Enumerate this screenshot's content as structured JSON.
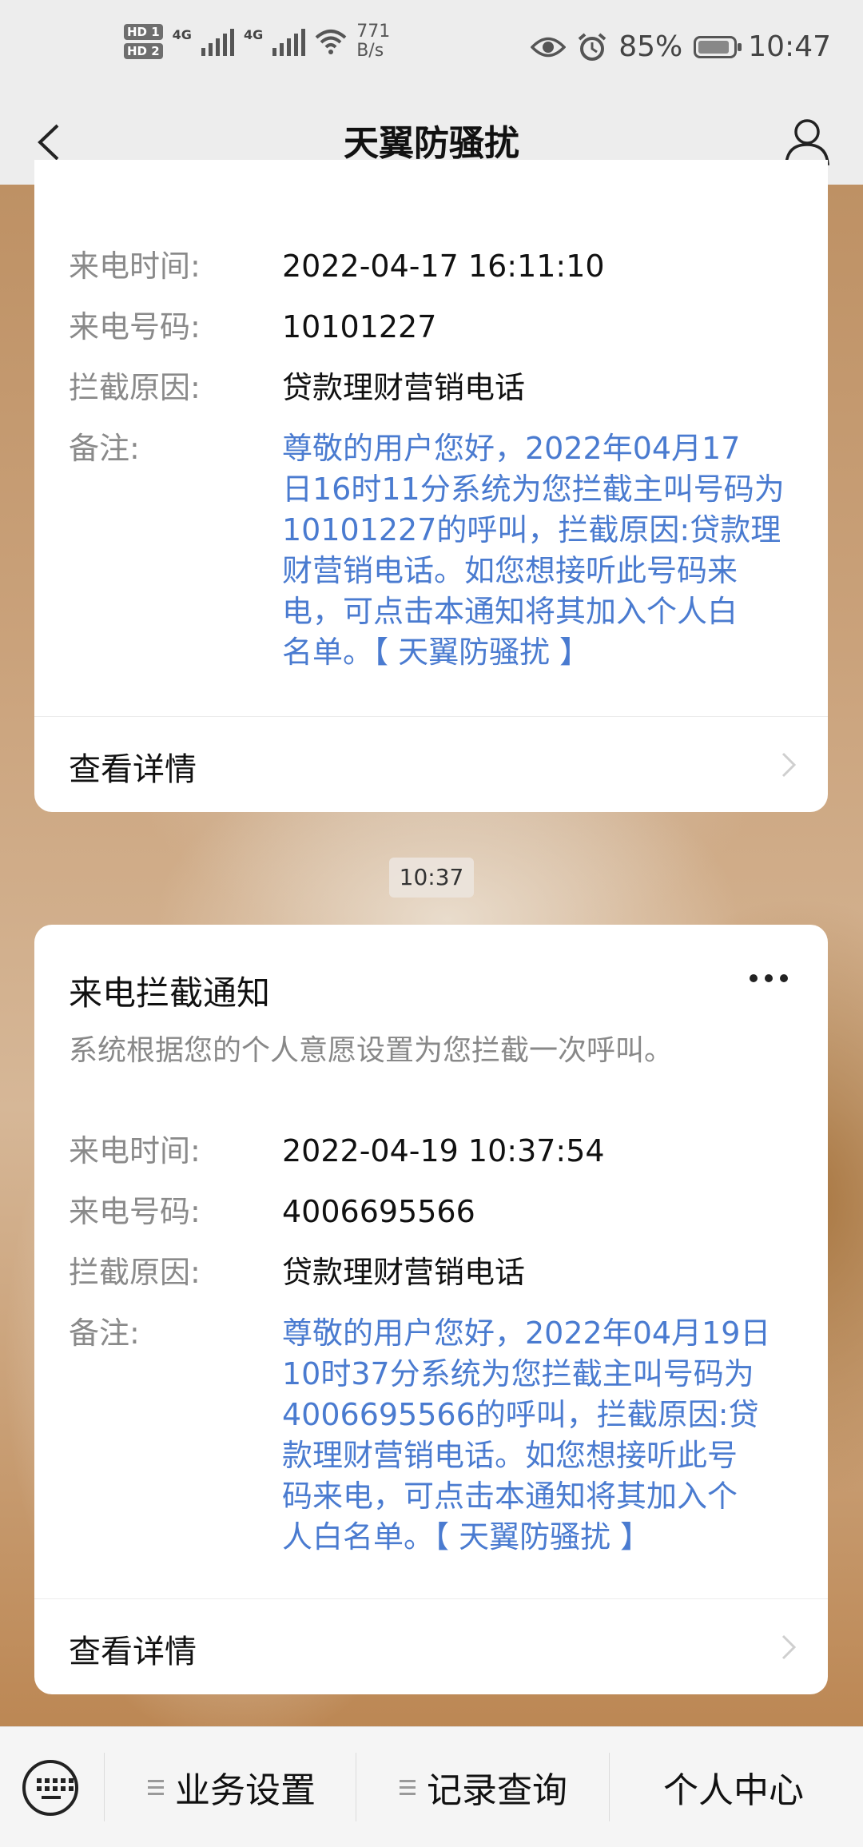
{
  "status_bar": {
    "hd1": "HD 1",
    "hd2": "HD 2",
    "net1": "4G",
    "net2": "4G",
    "speed_value": "771",
    "speed_unit": "B/s",
    "battery": "85%",
    "time": "10:47"
  },
  "header": {
    "title": "天翼防骚扰"
  },
  "card1": {
    "rows": [
      {
        "label": "来电时间:",
        "value": "2022-04-17 16:11:10"
      },
      {
        "label": "来电号码:",
        "value": "10101227"
      },
      {
        "label": "拦截原因:",
        "value": "贷款理财营销电话"
      }
    ],
    "note_label": "备注:",
    "note_lines": [
      "尊敬的用户您好，2022年04月17",
      "日16时11分系统为您拦截主叫号码为",
      "10101227的呼叫，拦截原因:贷款理",
      "财营销电话。如您想接听此号码来",
      "电，可点击本通知将其加入个人白",
      "名单。【 天翼防骚扰 】"
    ],
    "detail_label": "查看详情"
  },
  "time_chip": "10:37",
  "card2": {
    "title": "来电拦截通知",
    "subtitle": "系统根据您的个人意愿设置为您拦截一次呼叫。",
    "rows": [
      {
        "label": "来电时间:",
        "value": "2022-04-19 10:37:54"
      },
      {
        "label": "来电号码:",
        "value": "4006695566"
      },
      {
        "label": "拦截原因:",
        "value": "贷款理财营销电话"
      }
    ],
    "note_label": "备注:",
    "note_lines": [
      "尊敬的用户您好，2022年04月19日",
      "10时37分系统为您拦截主叫号码为",
      "4006695566的呼叫，拦截原因:贷",
      "款理财营销电话。如您想接听此号",
      "码来电，可点击本通知将其加入个",
      "人白名单。【 天翼防骚扰 】"
    ],
    "detail_label": "查看详情"
  },
  "bottom_nav": {
    "items": [
      "业务设置",
      "记录查询",
      "个人中心"
    ]
  },
  "colors": {
    "note_text": "#4a7bd0",
    "label_text": "#8a8a8a",
    "bar_bg": "#ededed"
  }
}
